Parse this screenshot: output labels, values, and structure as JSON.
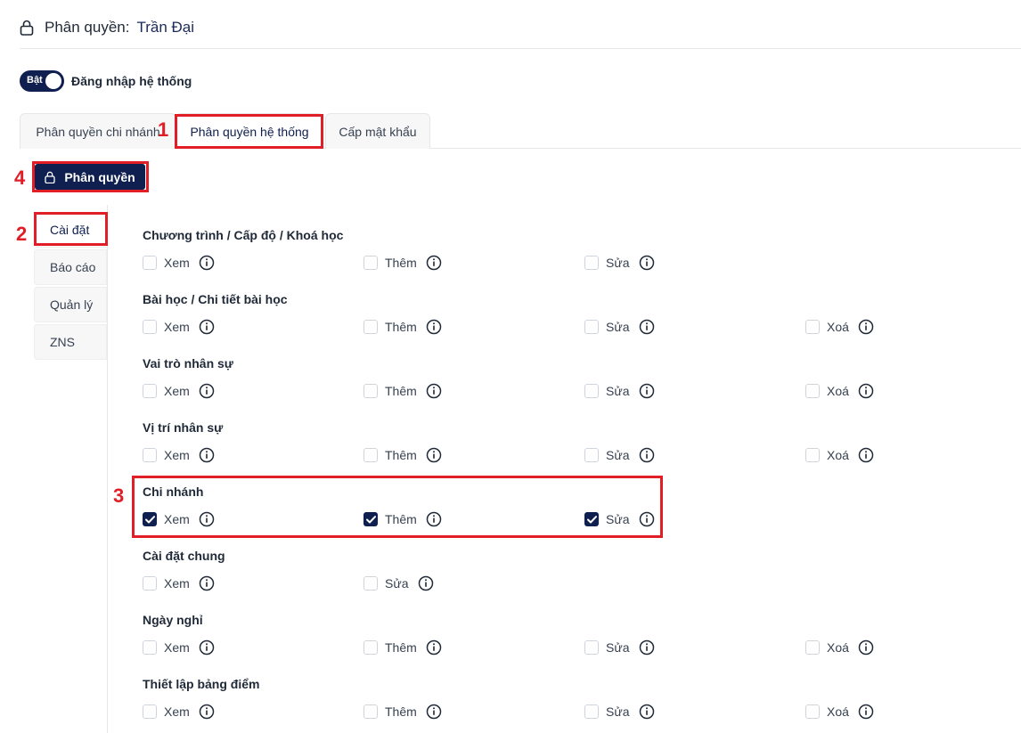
{
  "header": {
    "label": "Phân quyền:",
    "name": "Trần Đại"
  },
  "toggle": {
    "state_label": "Bật",
    "label": "Đăng nhập hệ thống",
    "on": true
  },
  "tabs": [
    {
      "label": "Phân quyền chi nhánh",
      "active": false
    },
    {
      "label": "Phân quyền hệ thống",
      "active": true
    },
    {
      "label": "Cấp mật khẩu",
      "active": false
    }
  ],
  "action_button": {
    "label": "Phân quyền"
  },
  "sidebar": {
    "items": [
      {
        "label": "Cài đặt",
        "active": true
      },
      {
        "label": "Báo cáo",
        "active": false
      },
      {
        "label": "Quản lý",
        "active": false
      },
      {
        "label": "ZNS",
        "active": false
      }
    ]
  },
  "annotations": [
    "1",
    "2",
    "3",
    "4"
  ],
  "groups": [
    {
      "title": "Chương trình / Cấp độ / Khoá học",
      "permissions": [
        {
          "label": "Xem",
          "checked": false
        },
        {
          "label": "Thêm",
          "checked": false
        },
        {
          "label": "Sửa",
          "checked": false
        }
      ]
    },
    {
      "title": "Bài học / Chi tiết bài học",
      "permissions": [
        {
          "label": "Xem",
          "checked": false
        },
        {
          "label": "Thêm",
          "checked": false
        },
        {
          "label": "Sửa",
          "checked": false
        },
        {
          "label": "Xoá",
          "checked": false
        }
      ]
    },
    {
      "title": "Vai trò nhân sự",
      "permissions": [
        {
          "label": "Xem",
          "checked": false
        },
        {
          "label": "Thêm",
          "checked": false
        },
        {
          "label": "Sửa",
          "checked": false
        },
        {
          "label": "Xoá",
          "checked": false
        }
      ]
    },
    {
      "title": "Vị trí nhân sự",
      "permissions": [
        {
          "label": "Xem",
          "checked": false
        },
        {
          "label": "Thêm",
          "checked": false
        },
        {
          "label": "Sửa",
          "checked": false
        },
        {
          "label": "Xoá",
          "checked": false
        }
      ]
    },
    {
      "title": "Chi nhánh",
      "permissions": [
        {
          "label": "Xem",
          "checked": true
        },
        {
          "label": "Thêm",
          "checked": true
        },
        {
          "label": "Sửa",
          "checked": true
        }
      ]
    },
    {
      "title": "Cài đặt chung",
      "permissions": [
        {
          "label": "Xem",
          "checked": false
        },
        {
          "label": "Sửa",
          "checked": false
        }
      ]
    },
    {
      "title": "Ngày nghỉ",
      "permissions": [
        {
          "label": "Xem",
          "checked": false
        },
        {
          "label": "Thêm",
          "checked": false
        },
        {
          "label": "Sửa",
          "checked": false
        },
        {
          "label": "Xoá",
          "checked": false
        }
      ]
    },
    {
      "title": "Thiết lập bảng điểm",
      "permissions": [
        {
          "label": "Xem",
          "checked": false
        },
        {
          "label": "Thêm",
          "checked": false
        },
        {
          "label": "Sửa",
          "checked": false
        },
        {
          "label": "Xoá",
          "checked": false
        }
      ]
    }
  ],
  "colors": {
    "primary": "#0f1f4f",
    "annotation_red": "#e11d26"
  }
}
